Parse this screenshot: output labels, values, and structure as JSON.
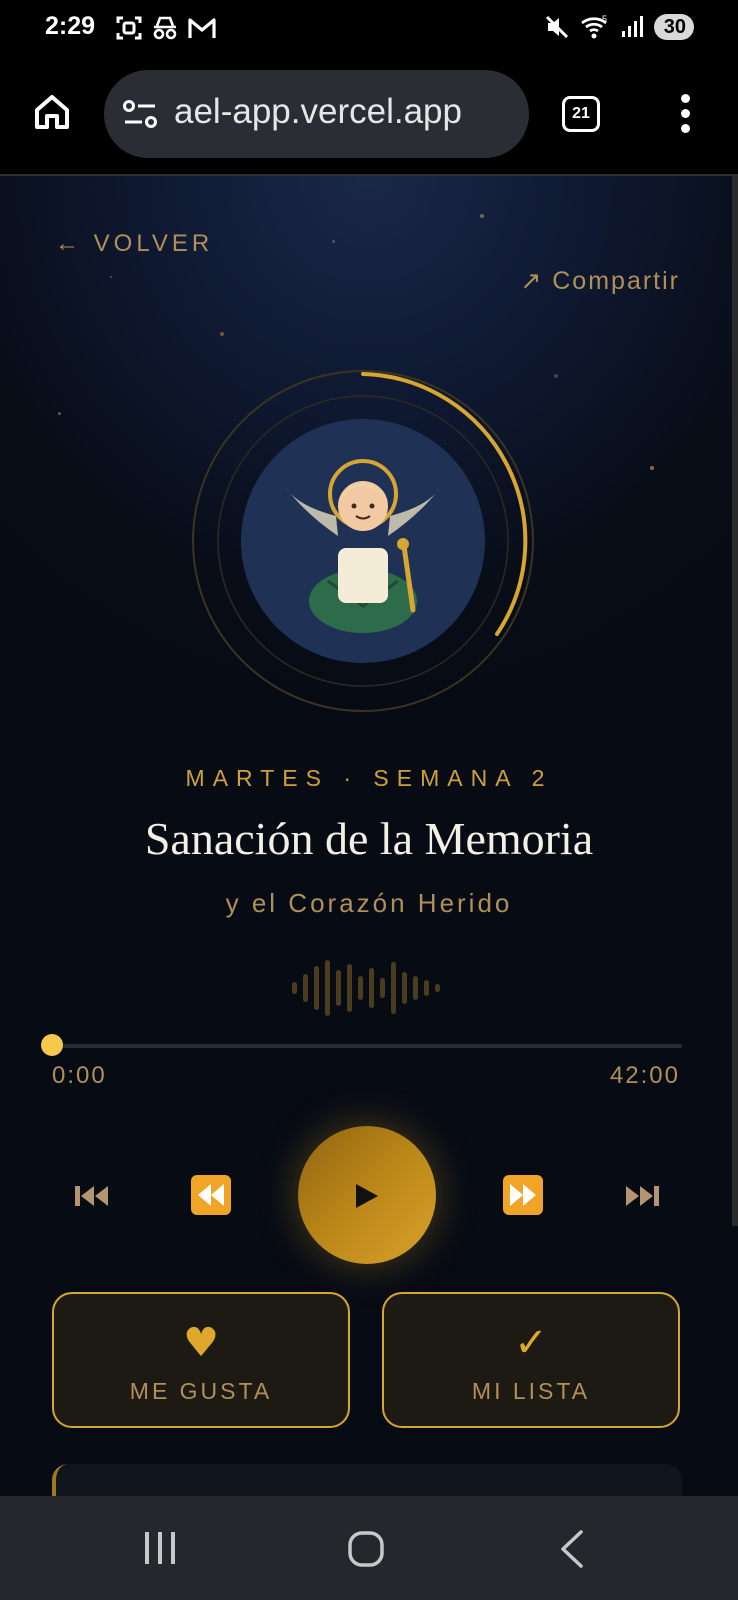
{
  "status_bar": {
    "time": "2:29",
    "battery": "30"
  },
  "browser": {
    "url": "ael-app.vercel.app",
    "tab_count": "21"
  },
  "page": {
    "back_label": "← VOLVER",
    "share_label": "↗ Compartir",
    "day_label": "MARTES · SEMANA 2",
    "title": "Sanación de la Memoria",
    "subtitle": "y el Corazón Herido"
  },
  "player": {
    "current_time": "0:00",
    "total_time": "42:00",
    "progress": 0.0,
    "state": "paused",
    "accent_color": "#d7a531"
  },
  "actions": {
    "like_icon": "heart-icon",
    "like_label": "ME GUSTA",
    "list_icon": "check-icon",
    "list_label": "MI LISTA"
  }
}
